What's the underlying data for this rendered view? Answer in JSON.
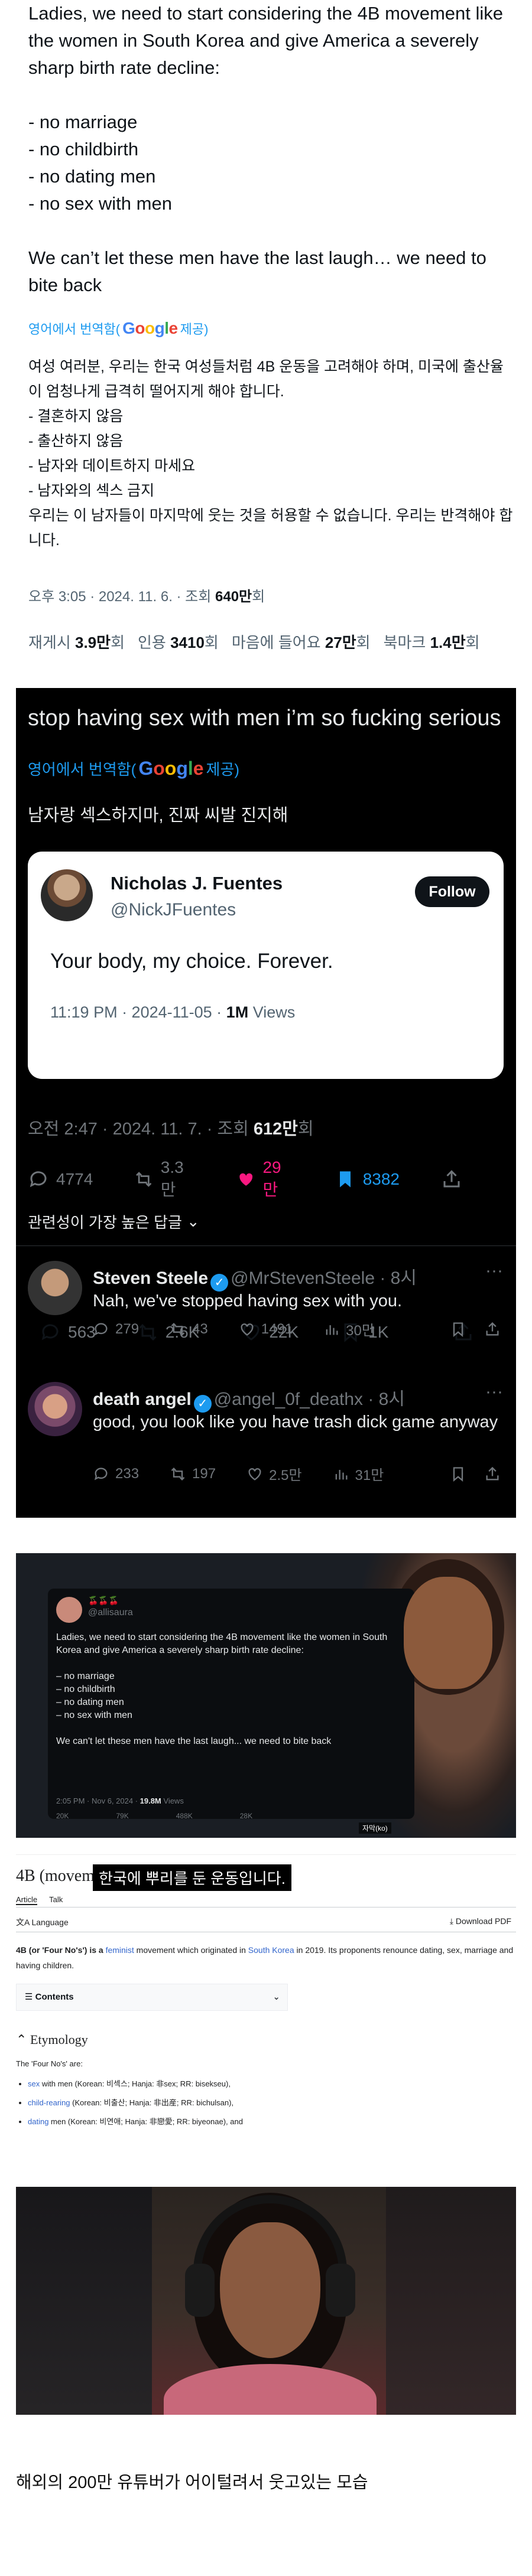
{
  "tweet1": {
    "body": "Ladies, we need to start considering the 4B movement like the women in South Korea and give America a severely sharp birth rate decline:\n\n- no marriage\n- no childbirth\n- no dating men\n- no sex with men\n\nWe can’t let these men have the last laugh… we need to bite back",
    "translate_prefix": "영어에서 번역함(",
    "google": [
      "G",
      "o",
      "o",
      "g",
      "l",
      "e"
    ],
    "translate_suffix": " 제공)",
    "korean": "여성 여러분, 우리는 한국 여성들처럼 4B 운동을 고려해야 하며, 미국에 출산율이 엄청나게 급격히 떨어지게 해야 합니다.\n- 결혼하지 않음\n- 출산하지 않음\n- 남자와 데이트하지 마세요\n- 남자와의 섹스 금지\n우리는 이 남자들이 마지막에 웃는 것을 허용할 수 없습니다. 우리는 반격해야 합니다.",
    "meta_time": "오후 3:05 · 2024. 11. 6. · 조회 ",
    "meta_views": "640만",
    "meta_views_suffix": "회",
    "stats": [
      {
        "label": "재게시",
        "value": "3.9만",
        "suffix": "회"
      },
      {
        "label": "인용",
        "value": "3410",
        "suffix": "회"
      },
      {
        "label": "마음에 들어요",
        "value": "27만",
        "suffix": "회"
      },
      {
        "label": "북마크",
        "value": "1.4만",
        "suffix": "회"
      }
    ]
  },
  "tweet2": {
    "title": "stop having sex with men i’m so fucking serious",
    "translate_prefix": "영어에서 번역함(",
    "google": [
      "G",
      "o",
      "o",
      "g",
      "l",
      "e"
    ],
    "translate_suffix": " 제공)",
    "korean": "남자랑 섹스하지마, 진짜 씨발 진지해",
    "quoted": {
      "name": "Nicholas J. Fuentes",
      "handle": "@NickJFuentes",
      "follow_label": "Follow",
      "text": "Your body, my choice. Forever.",
      "time": "11:19 PM · 2024-11-05 · ",
      "views": "1M",
      "views_label": " Views",
      "replies": "563",
      "reposts": "2.6K",
      "likes": "22K",
      "bookmarks": "1K"
    },
    "meta_time": "오전 2:47 · 2024. 11. 7. · 조회 ",
    "meta_views": "612만",
    "meta_views_suffix": "회",
    "replies": "4774",
    "reposts": "3.3만",
    "likes": "29만",
    "bookmarks": "8382",
    "like_color": "#f91880",
    "bookmark_color": "#1d9bf0",
    "relevance": "관련성이 가장 높은 답글",
    "comments": [
      {
        "name": "Steven Steele",
        "handle": "@MrStevenSteele · 8시",
        "text": "Nah, we've stopped having sex with you.",
        "replies": "279",
        "reposts": "43",
        "likes": "1491",
        "views": "30만"
      },
      {
        "name": "death angel",
        "handle": "@angel_0f_deathx · 8시",
        "text": "good, you look like you have trash dick game anyway",
        "replies": "233",
        "reposts": "197",
        "likes": "2.5만",
        "views": "31만"
      }
    ]
  },
  "video": {
    "emojis": "🍒🍒🍒",
    "handle": "@allisaura",
    "text": "Ladies, we need to start considering the 4B movement like the women in South Korea and give America a severely sharp birth rate decline:\n\n– no marriage\n– no childbirth\n– no dating men\n– no sex with men\n\nWe can't let these men have the last laugh... we need to bite back",
    "time": "2:05 PM · Nov 6, 2024 · ",
    "views": "19.8M",
    "views_label": " Views",
    "actions": [
      "20K",
      "79K",
      "488K",
      "28K"
    ],
    "subtitle": "자막(ko)"
  },
  "wiki": {
    "caption": "한국에 뿌리를 둔 운동입니다.",
    "title": "4B (movement)",
    "tabs": [
      "Article",
      "Talk"
    ],
    "language": "Language",
    "download": "Download PDF",
    "lead_parts": [
      "4B (or 'Four No's') is a ",
      "feminist",
      " movement which originated in ",
      "South Korea",
      " in 2019.",
      " Its proponents renounce dating, sex, marriage and having children."
    ],
    "contents": "Contents",
    "etymology": "Etymology",
    "four_nos": "The 'Four No's' are:",
    "items": [
      {
        "k": "sex",
        "rest": " with men (Korean: 비섹스; Hanja: 非sex; RR: bisekseu),"
      },
      {
        "k": "child-rearing",
        "rest": " (Korean: 비출산; Hanja: 非出産; RR: bichulsan),"
      },
      {
        "k": "dating",
        "rest": " men (Korean: 비연애; Hanja: 非戀愛; RR: biyeonae), and"
      }
    ]
  },
  "caption": "해외의 200만 유튜버가 어이털려서 웃고있는 모습"
}
